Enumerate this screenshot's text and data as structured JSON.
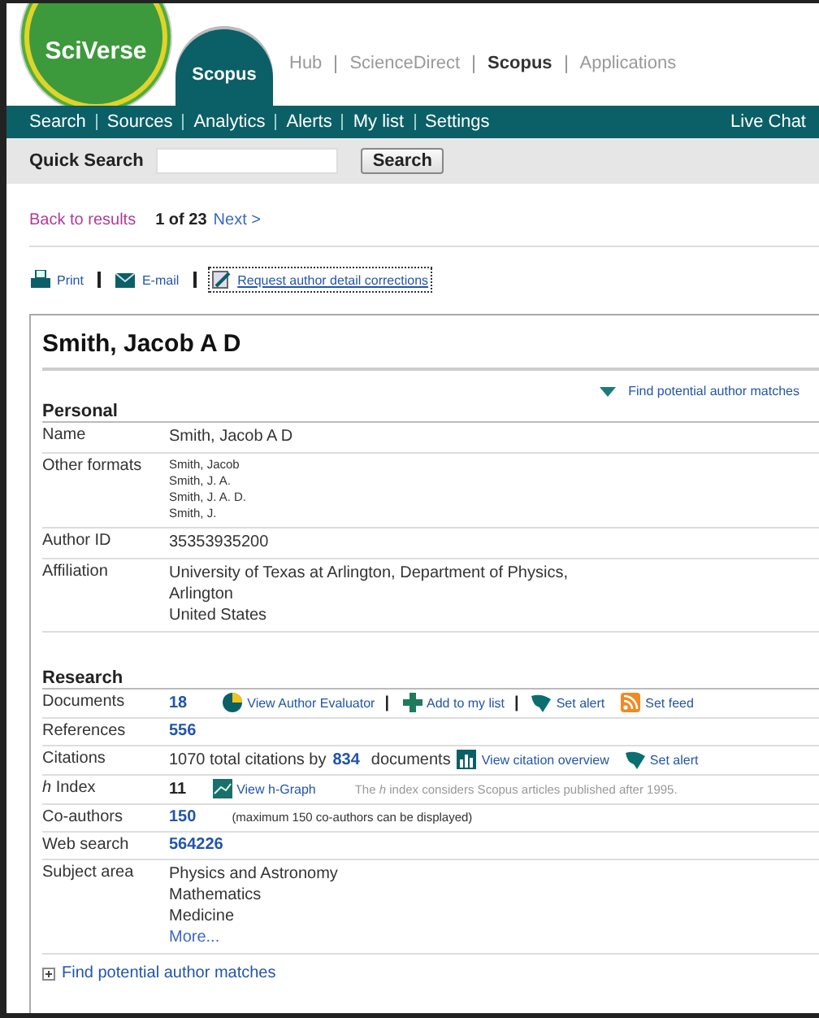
{
  "brand": {
    "logo": "SciVerse",
    "product": "Scopus"
  },
  "top_links": [
    {
      "label": "Hub",
      "selected": false
    },
    {
      "label": "ScienceDirect",
      "selected": false
    },
    {
      "label": "Scopus",
      "selected": true
    },
    {
      "label": "Applications",
      "selected": false
    }
  ],
  "nav": {
    "items": [
      "Search",
      "Sources",
      "Analytics",
      "Alerts",
      "My list",
      "Settings"
    ],
    "live_chat": "Live Chat"
  },
  "quick_search": {
    "label": "Quick Search",
    "button": "Search"
  },
  "pager": {
    "back": "Back to results",
    "position": "1 of 23",
    "next": "Next >"
  },
  "actions": [
    {
      "kind": "print",
      "label": "Print",
      "focused": false
    },
    {
      "kind": "mail",
      "label": "E-mail",
      "focused": false
    },
    {
      "kind": "edit",
      "label": "Request author detail corrections",
      "focused": true
    }
  ],
  "author": {
    "name": "Smith, Jacob A D",
    "find_matches": "Find potential author matches"
  },
  "personal": {
    "heading": "Personal",
    "rows": [
      {
        "label": "Name",
        "parts": [
          {
            "kind": "line",
            "text": "Smith, Jacob A D"
          }
        ]
      },
      {
        "label": "Other formats",
        "parts": [
          {
            "kind": "small",
            "text": "Smith, Jacob"
          },
          {
            "kind": "small",
            "text": "Smith, J. A."
          },
          {
            "kind": "small",
            "text": "Smith, J. A. D."
          },
          {
            "kind": "small",
            "text": "Smith, J."
          }
        ]
      },
      {
        "label": "Author ID",
        "parts": [
          {
            "kind": "line",
            "text": "35353935200"
          }
        ]
      },
      {
        "label": "Affiliation",
        "parts": [
          {
            "kind": "line",
            "text": "University of Texas at Arlington, Department of Physics,"
          },
          {
            "kind": "line",
            "text": "Arlington"
          },
          {
            "kind": "line",
            "text": "United States"
          }
        ]
      }
    ]
  },
  "research": {
    "heading": "Research",
    "rows": [
      {
        "label": "Documents",
        "parts": [
          {
            "kind": "link",
            "text": "18"
          },
          {
            "kind": "evaluate",
            "text": "View Author Evaluator"
          },
          {
            "kind": "sep",
            "text": "|"
          },
          {
            "kind": "add",
            "text": "Add to my list"
          },
          {
            "kind": "sep",
            "text": "|"
          },
          {
            "kind": "alert",
            "text": "Set alert"
          },
          {
            "kind": "feed",
            "text": "Set feed"
          }
        ]
      },
      {
        "label": "References",
        "parts": [
          {
            "kind": "link",
            "text": "556"
          }
        ]
      },
      {
        "label": "Citations",
        "parts": [
          {
            "kind": "text",
            "text": "1070 total citations by"
          },
          {
            "kind": "link",
            "text": "834"
          },
          {
            "kind": "text",
            "text": "documents"
          },
          {
            "kind": "overview",
            "text": "View citation overview"
          },
          {
            "kind": "alert",
            "text": "Set alert"
          }
        ]
      },
      {
        "label": "*h* Index",
        "parts": [
          {
            "kind": "bold",
            "text": "11"
          },
          {
            "kind": "graph",
            "text": "View h-Graph"
          },
          {
            "kind": "note",
            "text": "The *h* index considers Scopus articles published after 1995."
          }
        ]
      },
      {
        "label": "Co-authors",
        "parts": [
          {
            "kind": "link",
            "text": "150"
          },
          {
            "kind": "hint",
            "text": "(maximum 150 co-authors can be displayed)"
          }
        ]
      },
      {
        "label": "Web search",
        "parts": [
          {
            "kind": "link",
            "text": "564226"
          }
        ]
      },
      {
        "label": "Subject area",
        "parts": [
          {
            "kind": "line",
            "text": "Physics and Astronomy"
          },
          {
            "kind": "line",
            "text": "Mathematics"
          },
          {
            "kind": "line",
            "text": "Medicine"
          },
          {
            "kind": "more",
            "text": "More..."
          }
        ]
      }
    ]
  },
  "footer_link": "Find potential author matches"
}
